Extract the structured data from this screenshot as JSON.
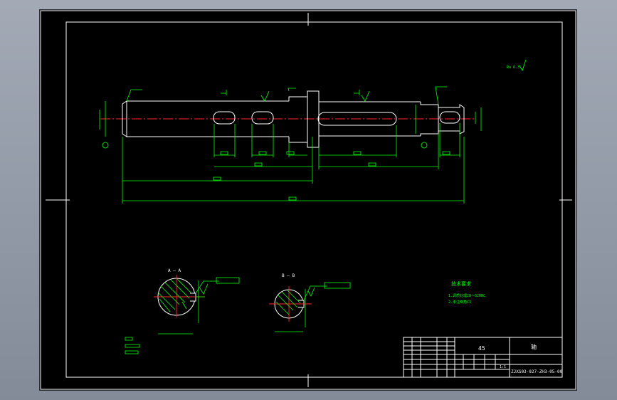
{
  "drawing": {
    "section_a_label": "A — A",
    "section_b_label": "B — B",
    "tech_title": "技术要求",
    "note_lines": [
      "1.调质处理28～32HRC",
      "2.未注倒角C1"
    ],
    "material": "45",
    "part_name": "轴",
    "drawing_number": "ZJXS03-027-ZH3-05-00",
    "scale": "1:1",
    "roughness_note": "Ra 6.3",
    "colors": {
      "geometry": "#ffffff",
      "dimension": "#00ff00",
      "centerline": "#ff2a2a",
      "background": "#000000"
    }
  }
}
